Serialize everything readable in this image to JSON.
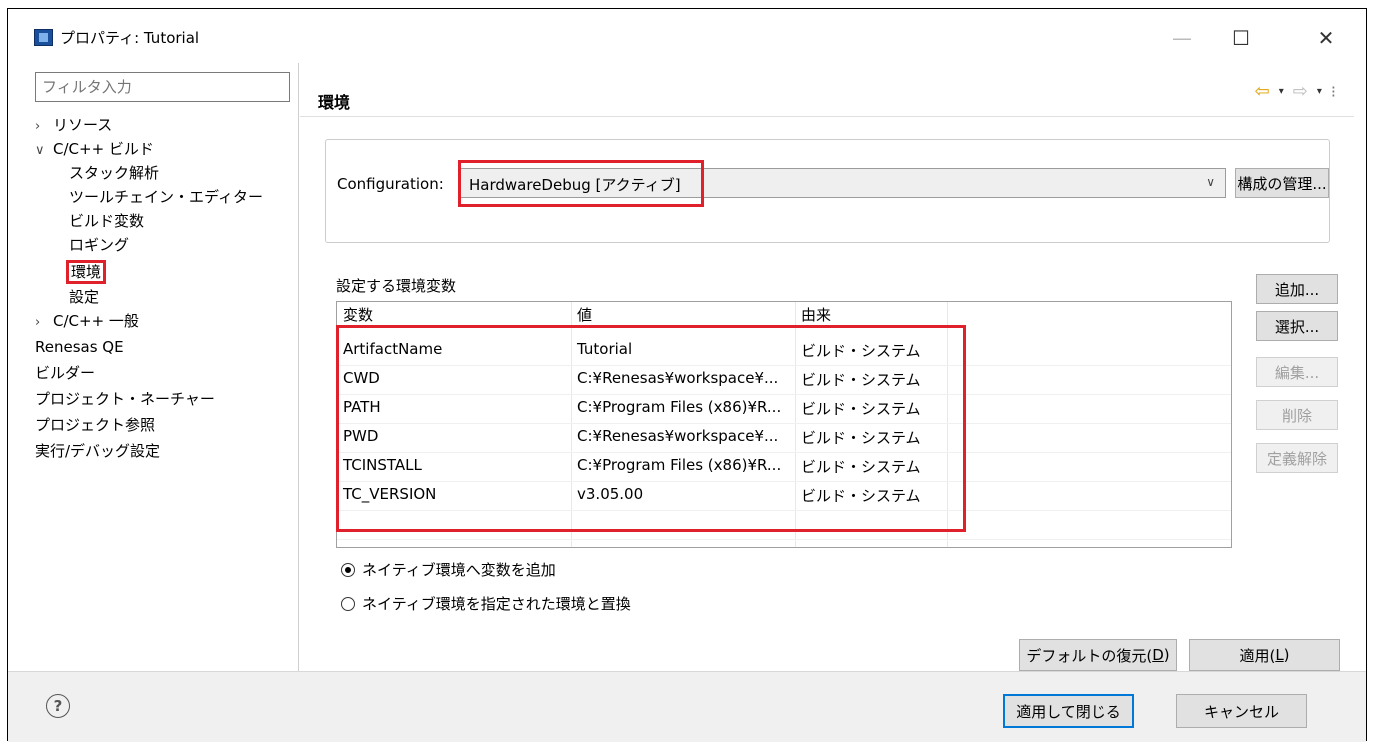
{
  "window": {
    "title": "プロパティ: Tutorial",
    "min": "—",
    "max": "☐",
    "close": "✕"
  },
  "filter": {
    "placeholder": "フィルタ入力"
  },
  "tree": [
    {
      "label": "リソース",
      "twisty": "›"
    },
    {
      "label": "C/C++ ビルド",
      "twisty": "∨"
    },
    {
      "label": "スタック解析"
    },
    {
      "label": "ツールチェイン・エディター"
    },
    {
      "label": "ビルド変数"
    },
    {
      "label": "ロギング"
    },
    {
      "label": "環境"
    },
    {
      "label": "設定"
    },
    {
      "label": "C/C++ 一般",
      "twisty": "›"
    },
    {
      "label": "Renesas QE"
    },
    {
      "label": "ビルダー"
    },
    {
      "label": "プロジェクト・ネーチャー"
    },
    {
      "label": "プロジェクト参照"
    },
    {
      "label": "実行/デバッグ設定"
    }
  ],
  "page": {
    "title": "環境"
  },
  "nav": {
    "back": "⇦",
    "dropdown": "▾",
    "forward": "⇨",
    "more": "⁝"
  },
  "configuration": {
    "label": "Configuration:",
    "value": "HardwareDebug  [アクティブ]",
    "chevron": "∨",
    "manage_button": "構成の管理..."
  },
  "env": {
    "label": "設定する環境変数",
    "columns": [
      "変数",
      "値",
      "由来"
    ],
    "rows": [
      [
        "ArtifactName",
        "Tutorial",
        "ビルド・システム"
      ],
      [
        "CWD",
        "C:¥Renesas¥workspace¥...",
        "ビルド・システム"
      ],
      [
        "PATH",
        "C:¥Program Files (x86)¥R...",
        "ビルド・システム"
      ],
      [
        "PWD",
        "C:¥Renesas¥workspace¥...",
        "ビルド・システム"
      ],
      [
        "TCINSTALL",
        "C:¥Program Files (x86)¥R...",
        "ビルド・システム"
      ],
      [
        "TC_VERSION",
        "v3.05.00",
        "ビルド・システム"
      ]
    ]
  },
  "side_buttons": {
    "add": "追加...",
    "select": "選択...",
    "edit": "編集...",
    "delete": "削除",
    "undefine": "定義解除"
  },
  "radios": {
    "append": "ネイティブ環境へ変数を追加",
    "replace": "ネイティブ環境を指定された環境と置換",
    "selected": "append"
  },
  "buttons": {
    "restore_defaults": "デフォルトの復元(",
    "restore_key": "D",
    "close_paren": ")",
    "apply": "適用(",
    "apply_key": "L",
    "apply_close": "適用して閉じる",
    "cancel": "キャンセル"
  },
  "help": {
    "glyph": "?"
  },
  "highlight_color": "#e0202b"
}
